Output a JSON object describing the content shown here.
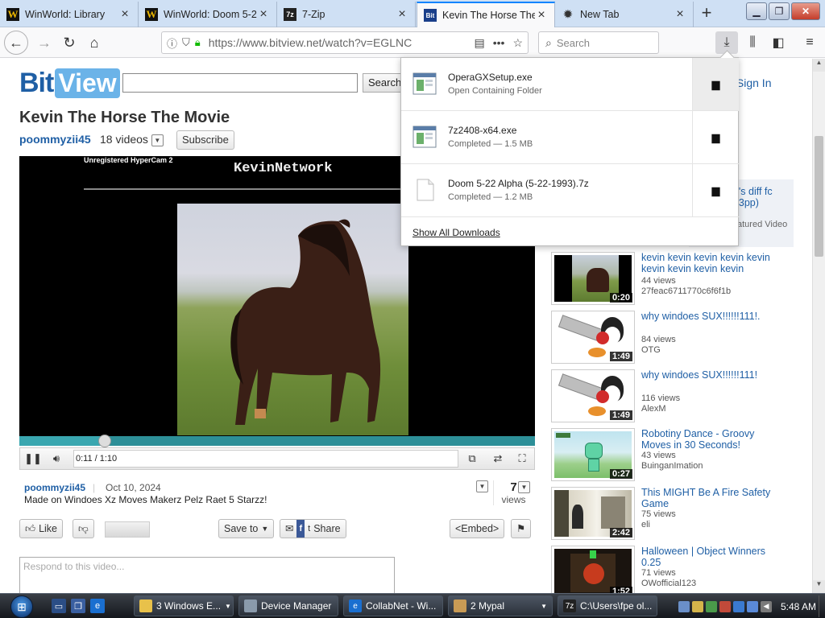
{
  "browser": {
    "tabs": [
      {
        "title": "WinWorld: Library",
        "icon": "winworld-icon",
        "active": false
      },
      {
        "title": "WinWorld: Doom 5-2",
        "icon": "winworld-icon",
        "active": false
      },
      {
        "title": "7-Zip",
        "icon": "7zip-icon",
        "active": false
      },
      {
        "title": "Kevin The Horse The",
        "icon": "bitview-icon",
        "active": true
      },
      {
        "title": "New Tab",
        "icon": "newtab-icon",
        "active": false
      }
    ],
    "url": "https://www.bitview.net/watch?v=EGLNC",
    "search_placeholder": "Search",
    "accent": "#0a84ff"
  },
  "site": {
    "logo_left": "Bit",
    "logo_right": "View",
    "search_button": "Search",
    "header_link_partial": "t",
    "sign_in": "Sign In"
  },
  "video": {
    "title": "Kevin The Horse The Movie",
    "uploader": "poommyzii45",
    "video_count": "18 videos",
    "subscribe": "Subscribe",
    "watermark": "Unregistered HyperCam 2",
    "overlay_title": "KevinNetwork",
    "time": "0:11 / 1:10",
    "progress": 0.165,
    "upload_date": "Oct 10, 2024",
    "description": "Made on Windoes Xz Moves Makerz Pelz Raet 5 Starzz!",
    "views_count": "7",
    "views_label": "views",
    "like": "Like",
    "save_to": "Save to",
    "share": "Share",
    "embed": "<Embed>",
    "respond_placeholder": "Respond to this video..."
  },
  "sidebar": {
    "featured_title": "oh's diff fc 723pp)",
    "featured_label": "atured Video",
    "related": [
      {
        "title": "kevin kevin kevin kevin kevin kevin kevin kevin kevin",
        "views": "44 views",
        "user": "27feac6711770c6f6f1b",
        "duration": "0:20",
        "thumb": "horse"
      },
      {
        "title": "why windoes SUX!!!!!!111!.",
        "views": "84 views",
        "user": "OTG",
        "duration": "1:49",
        "thumb": "tux"
      },
      {
        "title": "why windoes SUX!!!!!!111!",
        "views": "116 views",
        "user": "AlexM",
        "duration": "1:49",
        "thumb": "tux"
      },
      {
        "title": "Robotiny Dance - Groovy Moves in 30 Seconds!",
        "views": "43 views",
        "user": "BuinganImation",
        "duration": "0:27",
        "thumb": "robot"
      },
      {
        "title": "This MIGHT Be A Fire Safety Game",
        "views": "75 views",
        "user": "eli",
        "duration": "2:42",
        "thumb": "hall"
      },
      {
        "title": "Halloween | Object Winners 0.25",
        "views": "71 views",
        "user": "OWofficial123",
        "duration": "1:52",
        "thumb": "dark"
      }
    ]
  },
  "downloads": {
    "items": [
      {
        "name": "OperaGXSetup.exe",
        "status": "Open Containing Folder",
        "icon": "exe-icon"
      },
      {
        "name": "7z2408-x64.exe",
        "status": "Completed — 1.5 MB",
        "icon": "exe-icon"
      },
      {
        "name": "Doom 5-22 Alpha (5-22-1993).7z",
        "status": "Completed — 1.2 MB",
        "icon": "file-icon"
      }
    ],
    "show_all": "Show All Downloads"
  },
  "taskbar": {
    "buttons": [
      {
        "label": "3 Windows E...",
        "icon": "folder-icon"
      },
      {
        "label": "Device Manager",
        "icon": "device-manager-icon"
      },
      {
        "label": "CollabNet - Wi...",
        "icon": "ie-icon"
      },
      {
        "label": "2 Mypal",
        "icon": "mypal-icon"
      },
      {
        "label": "C:\\Users\\fpe ol...",
        "icon": "7zip-icon"
      }
    ],
    "clock": "5:48 AM"
  }
}
